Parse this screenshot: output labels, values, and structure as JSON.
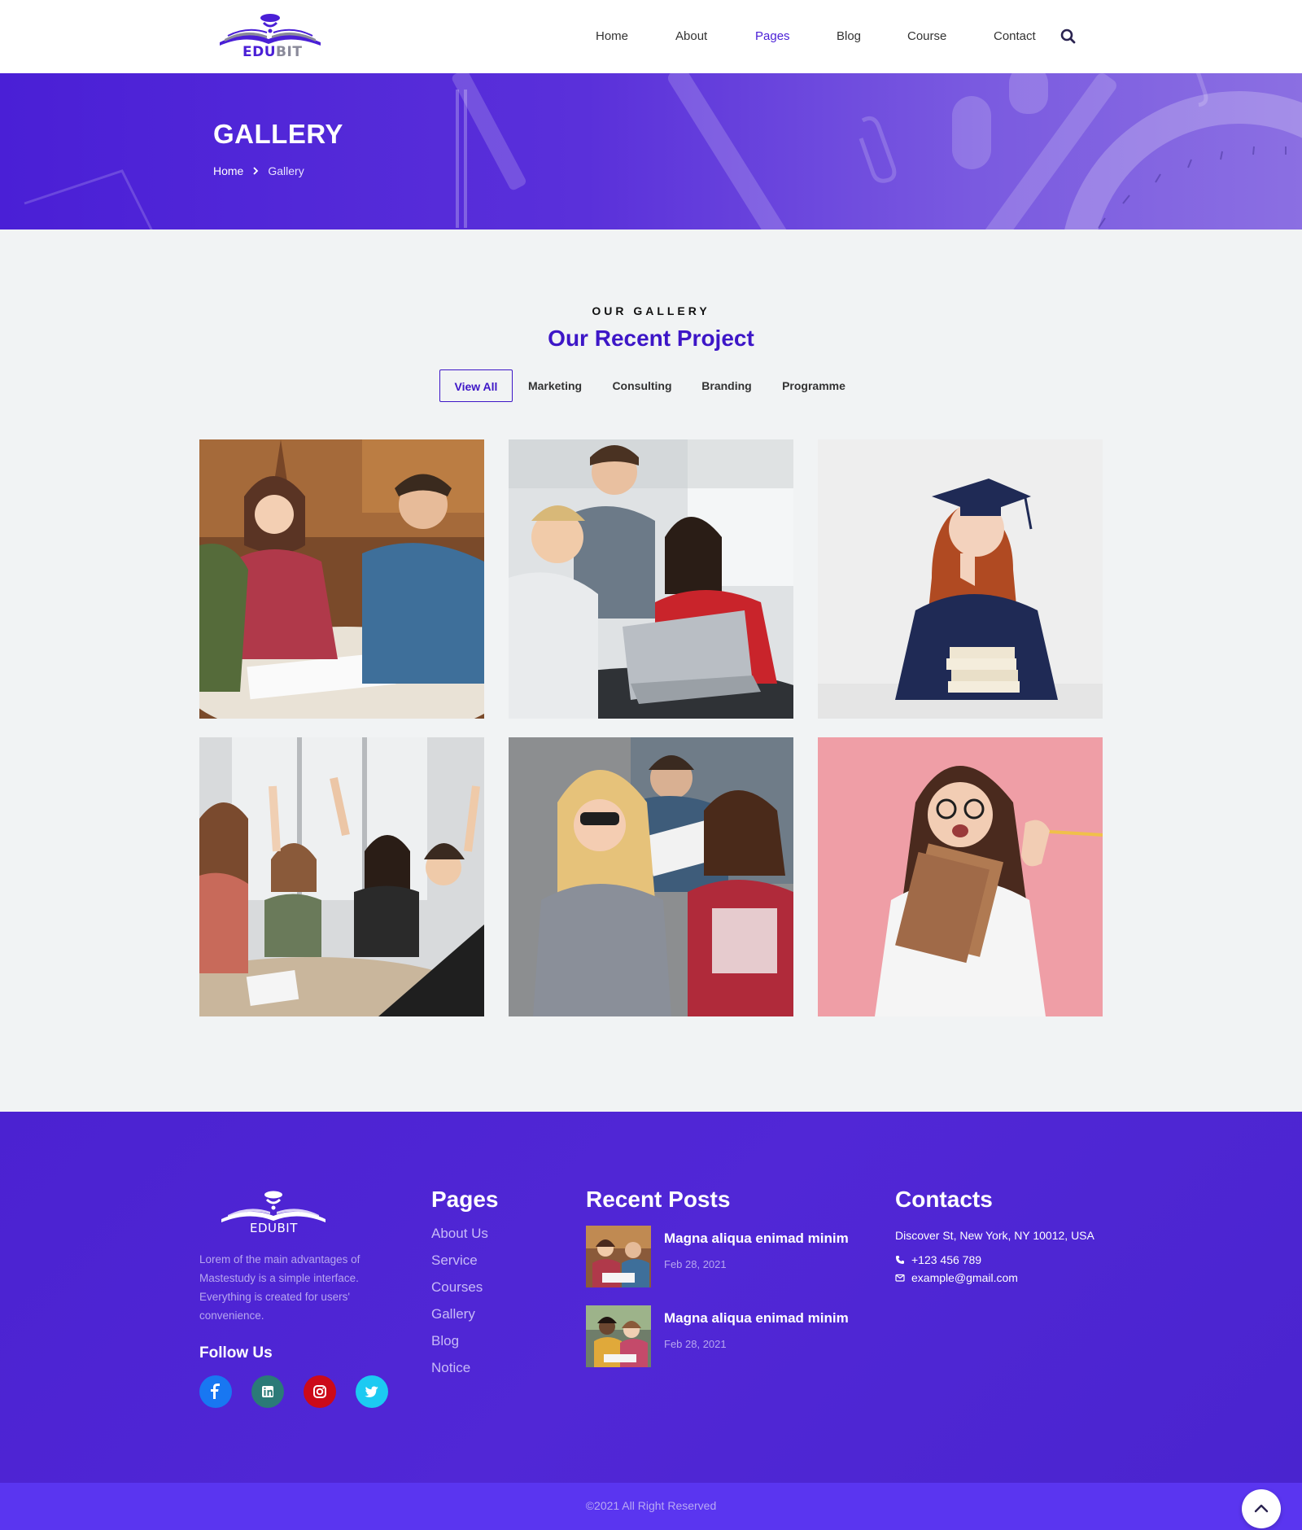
{
  "brand": {
    "logo_text_primary": "EDU",
    "logo_text_secondary": "BIT",
    "accent": "#3d16c7"
  },
  "nav": {
    "items": [
      {
        "label": "Home"
      },
      {
        "label": "About"
      },
      {
        "label": "Pages"
      },
      {
        "label": "Blog"
      },
      {
        "label": "Course"
      },
      {
        "label": "Contact"
      }
    ],
    "active": "Pages",
    "search_icon": "search-icon"
  },
  "banner": {
    "title": "GALLERY",
    "breadcrumb": {
      "home": "Home",
      "current": "Gallery"
    }
  },
  "gallery": {
    "eyebrow": "OUR GALLERY",
    "title": "Our Recent Project",
    "filters": [
      {
        "label": "View All",
        "active": true
      },
      {
        "label": "Marketing"
      },
      {
        "label": "Consulting"
      },
      {
        "label": "Branding"
      },
      {
        "label": "Programme"
      }
    ]
  },
  "footer": {
    "logo_text": "EDUBIT",
    "about": "Lorem of the main advantages of Mastestudy is a simple interface. Everything is created for users' convenience.",
    "follow_title": "Follow Us",
    "socials": [
      {
        "icon": "facebook-icon",
        "color": "#1877f2"
      },
      {
        "icon": "linkedin-icon",
        "color": "#2b7a78"
      },
      {
        "icon": "instagram-icon",
        "color": "#cc0a19"
      },
      {
        "icon": "twitter-icon",
        "color": "#1ccaf2"
      }
    ],
    "pages_title": "Pages",
    "pages": [
      "About Us",
      "Service",
      "Courses",
      "Gallery",
      "Blog",
      "Notice"
    ],
    "posts_title": "Recent Posts",
    "posts": [
      {
        "title": "Magna aliqua enimad minim",
        "date": "Feb 28, 2021"
      },
      {
        "title": "Magna aliqua enimad minim",
        "date": "Feb 28, 2021"
      }
    ],
    "contacts_title": "Contacts",
    "address": "Discover St, New York, NY 10012, USA",
    "phone": "+123 456 789",
    "email": "example@gmail.com",
    "copyright": "©2021 All Right Reserved"
  }
}
